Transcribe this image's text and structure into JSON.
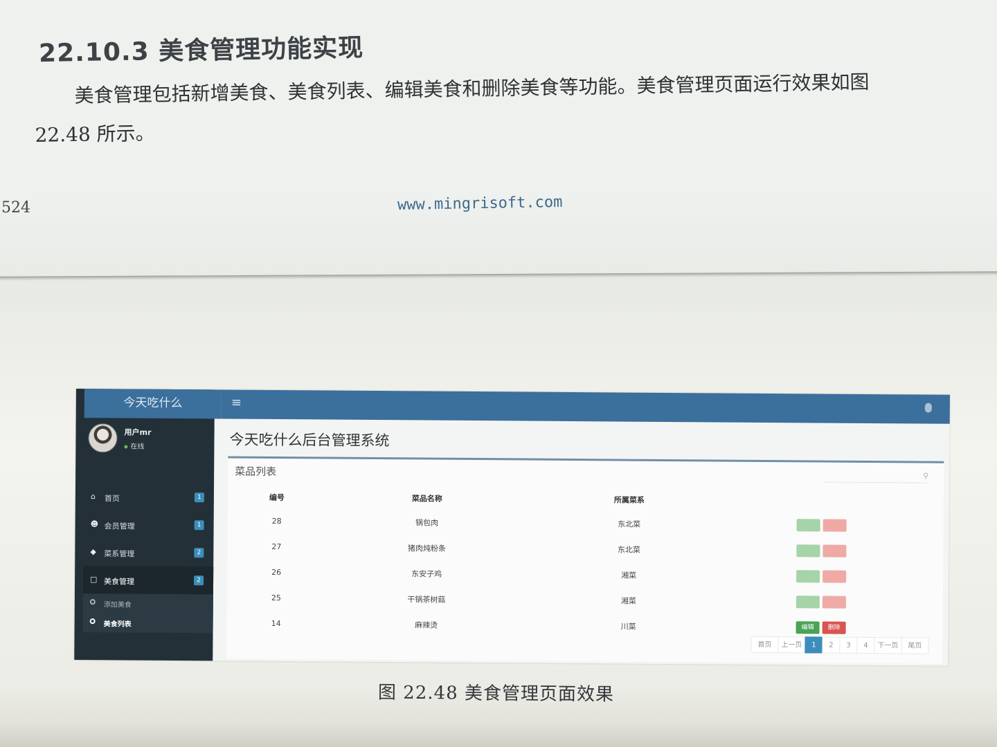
{
  "page": {
    "section_heading": "22.10.3 美食管理功能实现",
    "paragraph_line1": "美食管理包括新增美食、美食列表、编辑美食和删除美食等功能。美食管理页面运行效果如图",
    "paragraph_line2": "22.48 所示。",
    "page_number": "524",
    "site_url": "www.mingrisoft.com",
    "caption": "图 22.48  美食管理页面效果"
  },
  "app": {
    "brand": "今天吃什么",
    "user_name": "用户mr",
    "user_status": "在线",
    "nav": [
      {
        "label": "首页",
        "badge": "1",
        "icon": "home-icon"
      },
      {
        "label": "会员管理",
        "badge": "1",
        "icon": "users-icon"
      },
      {
        "label": "菜系管理",
        "badge": "2",
        "icon": "tag-icon"
      },
      {
        "label": "美食管理",
        "badge": "2",
        "icon": "file-icon"
      }
    ],
    "sub_nav": [
      {
        "label": "添加美食"
      },
      {
        "label": "美食列表"
      }
    ],
    "content_title": "今天吃什么后台管理系统",
    "box_title": "菜品列表",
    "table": {
      "headers": [
        "编号",
        "菜品名称",
        "所属菜系"
      ],
      "rows": [
        {
          "id": "28",
          "name": "锅包肉",
          "cuisine": "东北菜"
        },
        {
          "id": "27",
          "name": "猪肉炖粉条",
          "cuisine": "东北菜"
        },
        {
          "id": "26",
          "name": "东安子鸡",
          "cuisine": "湘菜"
        },
        {
          "id": "25",
          "name": "干锅茶树菇",
          "cuisine": "湘菜"
        },
        {
          "id": "14",
          "name": "麻辣烫",
          "cuisine": "川菜"
        }
      ],
      "edit_label": "编辑",
      "delete_label": "删除"
    },
    "pagination": {
      "first": "首页",
      "prev": "上一页",
      "pages": [
        "1",
        "2",
        "3",
        "4"
      ],
      "current": "1",
      "next": "下一页",
      "last": "尾页"
    },
    "colors": {
      "topbar": "#3b6f9c",
      "sidebar": "#233038",
      "badge": "#3c8dbc",
      "edit": "#4aa354",
      "delete": "#d9534f"
    }
  }
}
